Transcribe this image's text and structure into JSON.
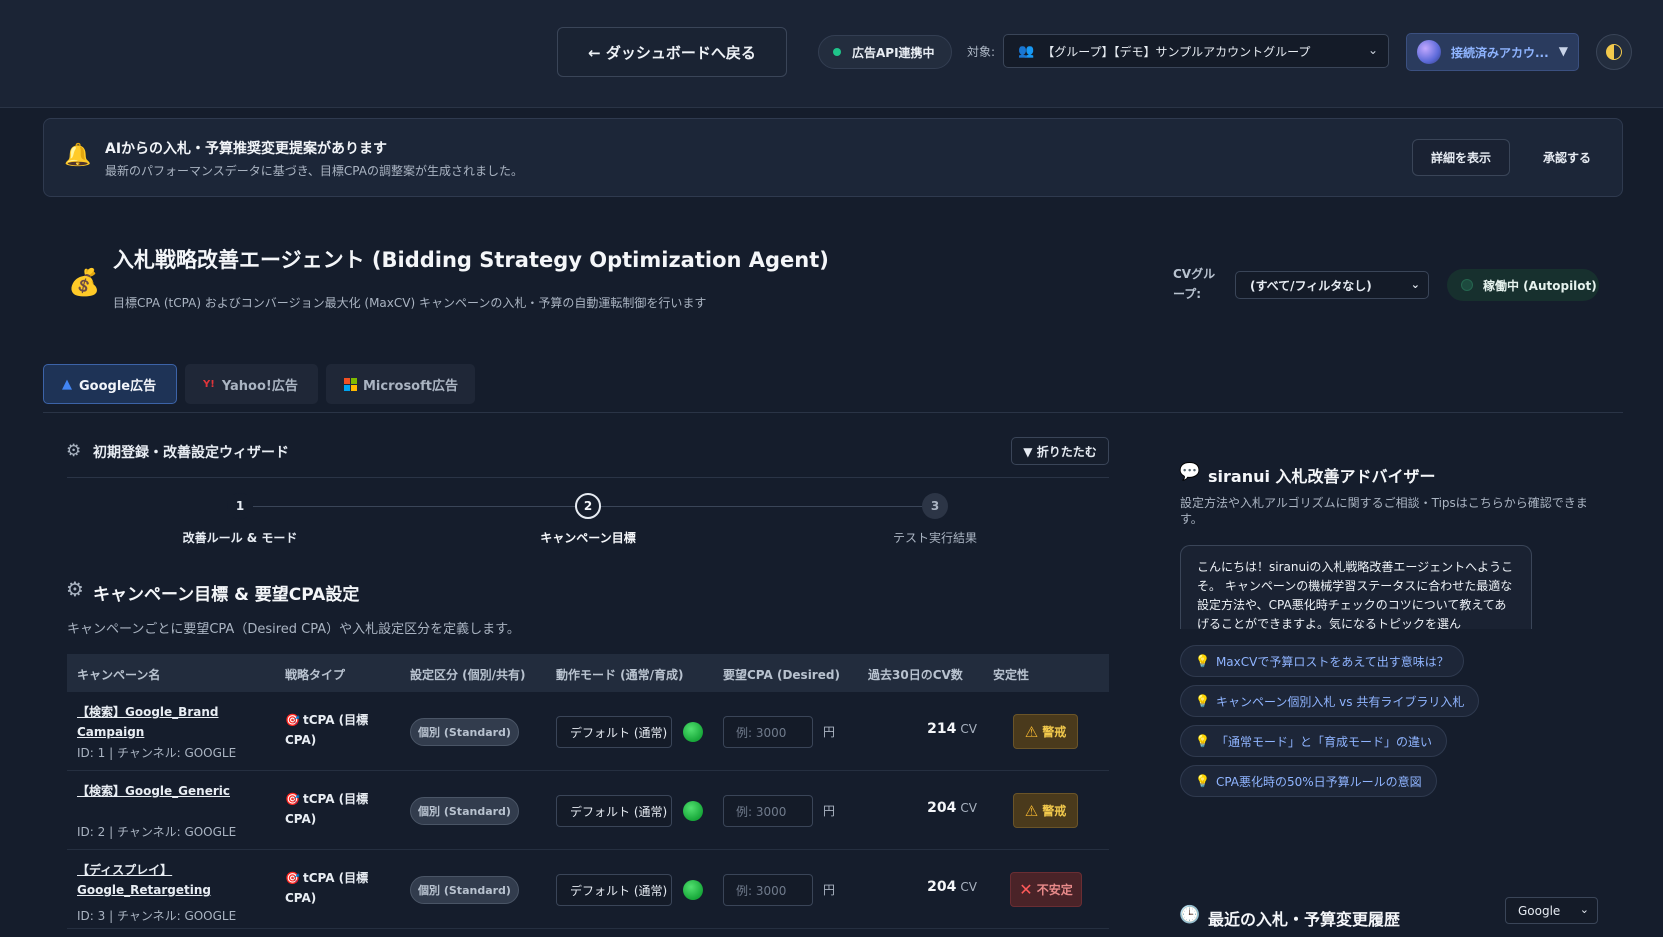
{
  "header": {
    "back_label": "← ダッシュボードへ戻る",
    "api_status": "広告API連携中",
    "target_label": "対象:",
    "target_value": "【グループ】【デモ】サンプルアカウントグループ",
    "account_label": "接続済みアカウ..."
  },
  "notice": {
    "title": "AIからの入札・予算推奨変更提案があります",
    "subtitle": "最新のパフォーマンスデータに基づき、目標CPAの調整案が生成されました。",
    "detail_button": "詳細を表示",
    "approve_button": "承認する"
  },
  "page": {
    "title": "入札戦略改善エージェント (Bidding Strategy Optimization Agent)",
    "subtitle": "目標CPA (tCPA) およびコンバージョン最大化 (MaxCV) キャンペーンの入札・予算の自動運転制御を行います",
    "cv_group_label": "CVグループ:",
    "cv_group_value": "(すべて/フィルタなし)",
    "status": "稼働中 (Autopilot)"
  },
  "tabs": [
    {
      "label": "Google広告"
    },
    {
      "label": "Yahoo!広告"
    },
    {
      "label": "Microsoft広告"
    }
  ],
  "wizard": {
    "title": "初期登録・改善設定ウィザード",
    "collapse_label": "▼ 折りたたむ",
    "steps": [
      {
        "num": "1",
        "label": "改善ルール & モード"
      },
      {
        "num": "2",
        "label": "キャンペーン目標"
      },
      {
        "num": "3",
        "label": "テスト実行結果"
      }
    ]
  },
  "section": {
    "title": "キャンペーン目標 & 要望CPA設定",
    "subtitle": "キャンペーンごとに要望CPA（Desired CPA）や入札設定区分を定義します。"
  },
  "table": {
    "headers": [
      "キャンペーン名",
      "戦略タイプ",
      "設定区分 (個別/共有)",
      "動作モード (通常/育成)",
      "要望CPA (Desired)",
      "過去30日のCV数",
      "安定性"
    ],
    "rows": [
      {
        "name": "【検索】Google_Brand Campaign",
        "id": "ID: 1 | チャンネル: GOOGLE",
        "type": "tCPA (目標CPA)",
        "setting": "個別 (Standard)",
        "mode": "デフォルト (通常)",
        "cpa_placeholder": "例: 3000",
        "yen": "円",
        "cv": "214",
        "cv_unit": "CV",
        "stability": "警戒"
      },
      {
        "name": "【検索】Google_Generic",
        "id": "ID: 2 | チャンネル: GOOGLE",
        "type": "tCPA (目標CPA)",
        "setting": "個別 (Standard)",
        "mode": "デフォルト (通常)",
        "cpa_placeholder": "例: 3000",
        "yen": "円",
        "cv": "204",
        "cv_unit": "CV",
        "stability": "警戒"
      },
      {
        "name": "【ディスプレイ】Google_Retargeting",
        "id": "ID: 3 | チャンネル: GOOGLE",
        "type": "tCPA (目標CPA)",
        "setting": "個別 (Standard)",
        "mode": "デフォルト (通常)",
        "cpa_placeholder": "例: 3000",
        "yen": "円",
        "cv": "204",
        "cv_unit": "CV",
        "stability": "不安定"
      }
    ]
  },
  "advisor": {
    "title": "siranui 入札改善アドバイザー",
    "subtitle": "設定方法や入札アルゴリズムに関するご相談・Tipsはこちらから確認できます。",
    "message": "こんにちは！siranuiの入札戦略改善エージェントへようこそ。 キャンペーンの機械学習ステータスに合わせた最適な設定方法や、CPA悪化時チェックのコツについて教えてあげることができますよ。気になるトピックを選ん",
    "chips": [
      "MaxCVで予算ロストをあえて出す意味は？",
      "キャンペーン個別入札 vs 共有ライブラリ入札",
      "「通常モード」と「育成モード」の違い",
      "CPA悪化時の50%日予算ルールの意図"
    ]
  },
  "history": {
    "title": "最近の入札・予算変更履歴",
    "filter": "Google"
  },
  "colors": {
    "background": "#151d2c",
    "accent": "#3c63a8",
    "success": "#1fc48a",
    "warning": "#f2c94c",
    "danger": "#ff5a5a"
  }
}
